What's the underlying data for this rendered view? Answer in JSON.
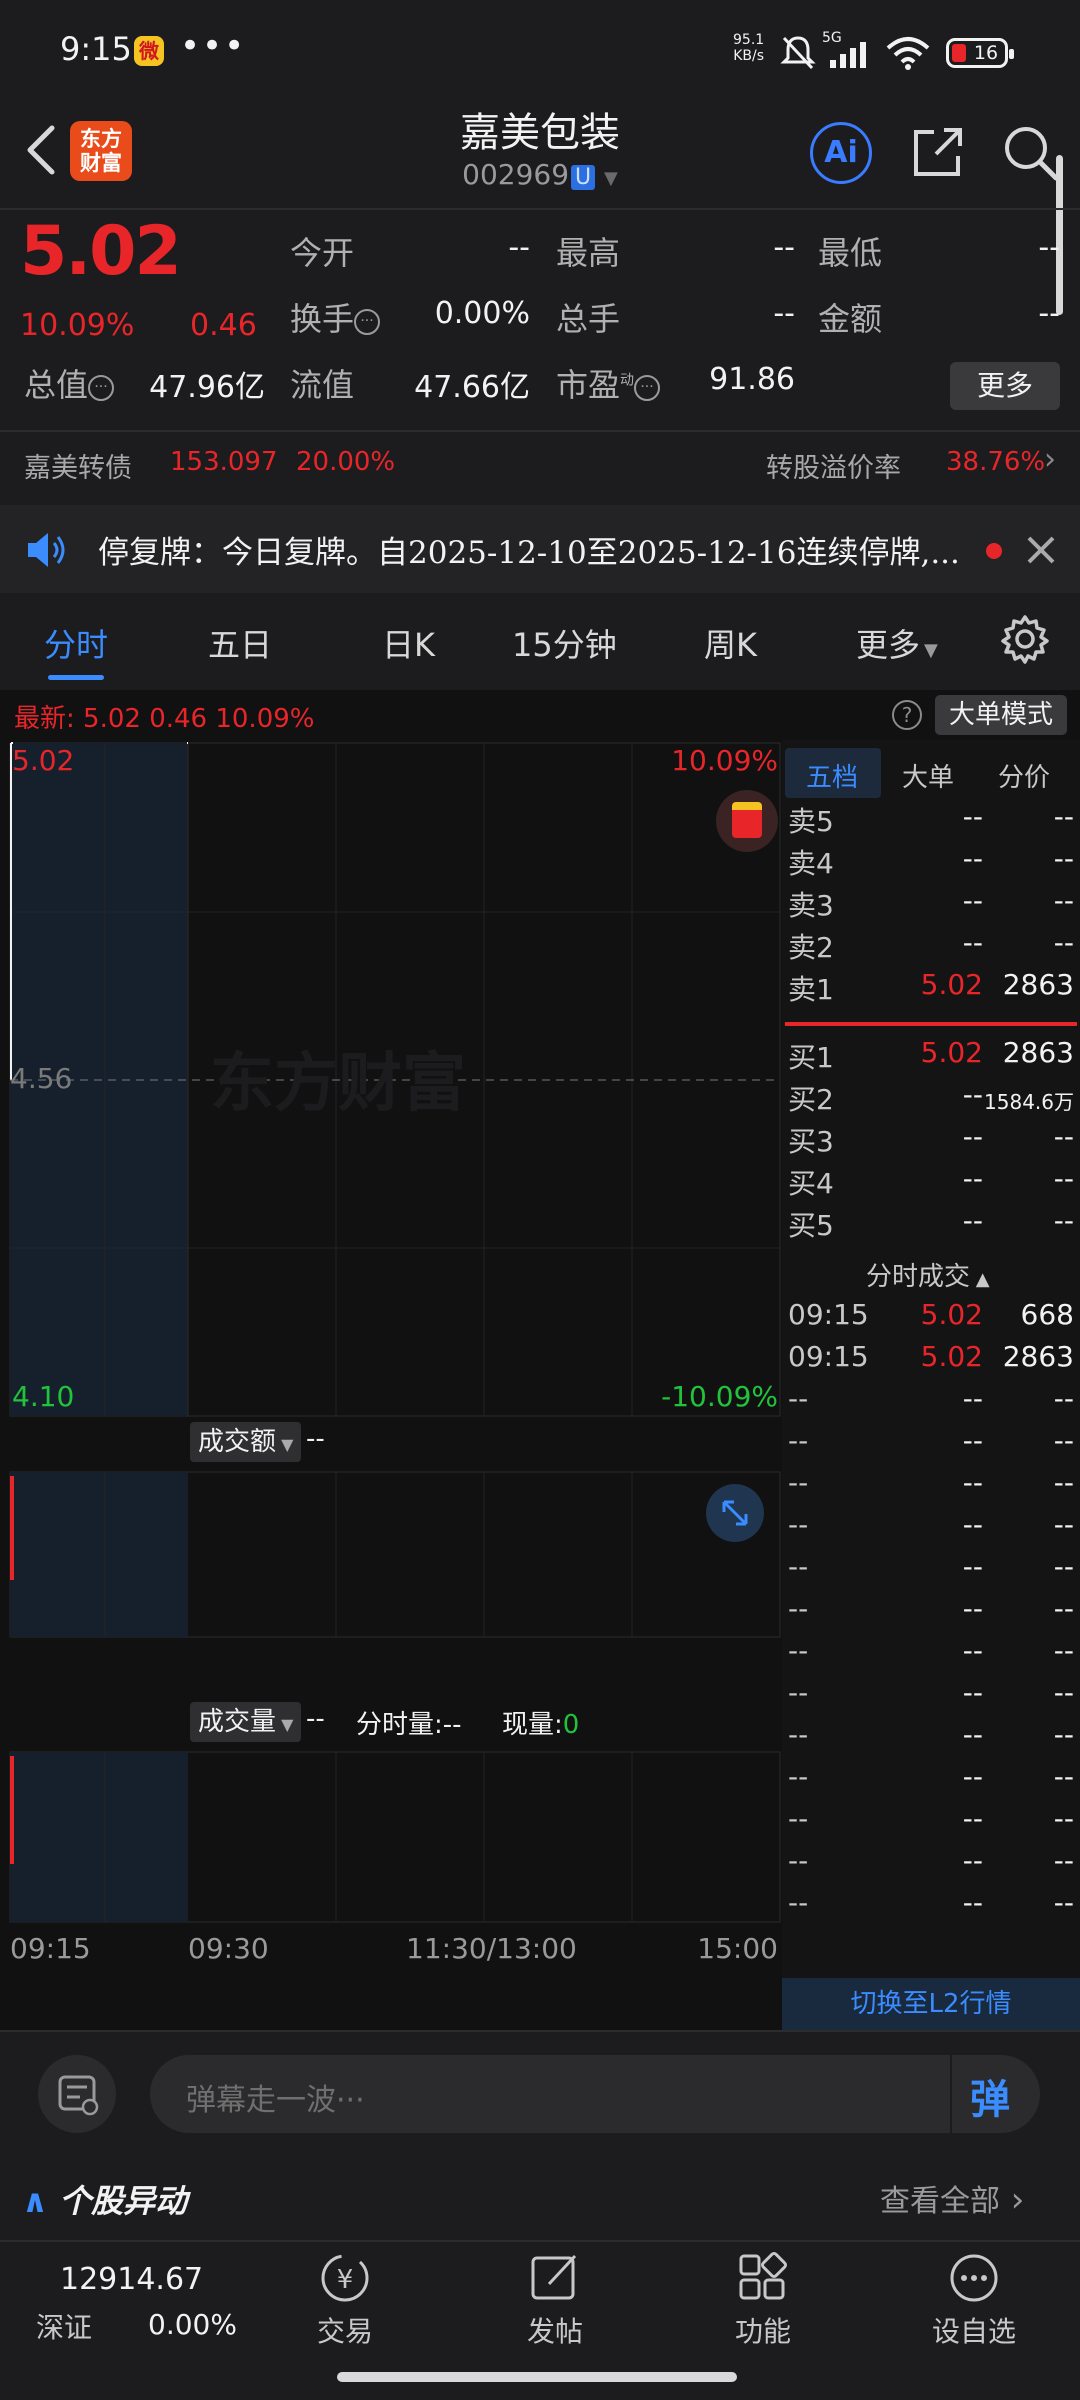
{
  "status_bar": {
    "time": "9:15",
    "dots": "•••",
    "net_speed_value": "95.1",
    "net_speed_unit": "KB/s",
    "network": "5G",
    "battery": "16"
  },
  "header": {
    "logo_text_line1": "东方",
    "logo_text_line2": "财富",
    "stock_name": "嘉美包装",
    "stock_code": "002969",
    "code_tag": "U",
    "ai_label": "Ai"
  },
  "quote": {
    "price": "5.02",
    "change_pct": "10.09%",
    "change_amt": "0.46",
    "fields": {
      "open_label": "今开",
      "open_value": "--",
      "high_label": "最高",
      "high_value": "--",
      "low_label": "最低",
      "low_value": "--",
      "turnover_label": "换手",
      "turnover_value": "0.00%",
      "total_hands_label": "总手",
      "total_hands_value": "--",
      "amount_label": "金额",
      "amount_value": "--",
      "mkt_cap_label": "总值",
      "mkt_cap_value": "47.96亿",
      "float_cap_label": "流值",
      "float_cap_value": "47.66亿",
      "pe_label": "市盈",
      "pe_sup": "动",
      "pe_value": "91.86"
    },
    "more_label": "更多"
  },
  "bond": {
    "name": "嘉美转债",
    "price": "153.097",
    "change": "20.00%",
    "premium_label": "转股溢价率",
    "premium_value": "38.76%"
  },
  "notice": {
    "text": "停复牌：今日复牌。自2025-12-10至2025-12-16连续停牌,..."
  },
  "tabs": [
    {
      "label": "分时"
    },
    {
      "label": "五日"
    },
    {
      "label": "日K"
    },
    {
      "label": "15分钟"
    },
    {
      "label": "周K"
    },
    {
      "label": "更多"
    }
  ],
  "chart": {
    "latest_label": "最新:",
    "latest_price": "5.02",
    "latest_change": "0.46",
    "latest_pct": "10.09%",
    "big_order_mode": "大单模式",
    "watermark": "东方财富",
    "amount_label": "成交额",
    "amount_value": "--",
    "volume_label": "成交量",
    "volume_value": "--",
    "tick_vol_label": "分时量:",
    "tick_vol_value": "--",
    "current_vol_label": "现量:",
    "current_vol_value": "0",
    "time_axis": [
      "09:15",
      "09:30",
      "11:30/13:00",
      "15:00"
    ]
  },
  "chart_data": {
    "type": "line",
    "title": "",
    "y_labels": {
      "top": "5.02",
      "mid": "4.56",
      "bottom": "4.10"
    },
    "pct_labels": {
      "top": "10.09%",
      "bottom": "-10.09%"
    },
    "ylim": [
      4.1,
      5.02
    ],
    "prev_close": 4.56,
    "x": [
      "09:15",
      "09:30",
      "11:30/13:00",
      "15:00"
    ],
    "series": [],
    "grid": true
  },
  "orderbook": {
    "tabs": [
      "五档",
      "大单",
      "分价"
    ],
    "asks": [
      {
        "label": "卖5",
        "price": "--",
        "vol": "--"
      },
      {
        "label": "卖4",
        "price": "--",
        "vol": "--"
      },
      {
        "label": "卖3",
        "price": "--",
        "vol": "--"
      },
      {
        "label": "卖2",
        "price": "--",
        "vol": "--"
      },
      {
        "label": "卖1",
        "price": "5.02",
        "vol": "2863"
      }
    ],
    "bids": [
      {
        "label": "买1",
        "price": "5.02",
        "vol": "2863"
      },
      {
        "label": "买2",
        "price": "--",
        "vol": "1584.6万"
      },
      {
        "label": "买3",
        "price": "--",
        "vol": "--"
      },
      {
        "label": "买4",
        "price": "--",
        "vol": "--"
      },
      {
        "label": "买5",
        "price": "--",
        "vol": "--"
      }
    ],
    "ticks_title": "分时成交",
    "ticks": [
      {
        "time": "09:15",
        "price": "5.02",
        "vol": "668"
      },
      {
        "time": "09:15",
        "price": "5.02",
        "vol": "2863"
      },
      {
        "time": "--",
        "price": "--",
        "vol": "--"
      },
      {
        "time": "--",
        "price": "--",
        "vol": "--"
      },
      {
        "time": "--",
        "price": "--",
        "vol": "--"
      },
      {
        "time": "--",
        "price": "--",
        "vol": "--"
      },
      {
        "time": "--",
        "price": "--",
        "vol": "--"
      },
      {
        "time": "--",
        "price": "--",
        "vol": "--"
      },
      {
        "time": "--",
        "price": "--",
        "vol": "--"
      },
      {
        "time": "--",
        "price": "--",
        "vol": "--"
      },
      {
        "time": "--",
        "price": "--",
        "vol": "--"
      },
      {
        "time": "--",
        "price": "--",
        "vol": "--"
      },
      {
        "time": "--",
        "price": "--",
        "vol": "--"
      },
      {
        "time": "--",
        "price": "--",
        "vol": "--"
      },
      {
        "time": "--",
        "price": "--",
        "vol": "--"
      }
    ],
    "l2_button": "切换至L2行情"
  },
  "danmu": {
    "placeholder": "弹幕走一波···",
    "send_label": "弹"
  },
  "stock_move": {
    "title": "个股异动",
    "view_all": "查看全部"
  },
  "bottom_nav": {
    "index_value": "12914.67",
    "index_name": "深证",
    "index_change": "0.00%",
    "items": [
      {
        "label": "交易"
      },
      {
        "label": "发帖"
      },
      {
        "label": "功能"
      },
      {
        "label": "设自选"
      }
    ]
  },
  "colors": {
    "up": "#e8262a",
    "down": "#22c33b",
    "accent": "#3a8cff"
  }
}
